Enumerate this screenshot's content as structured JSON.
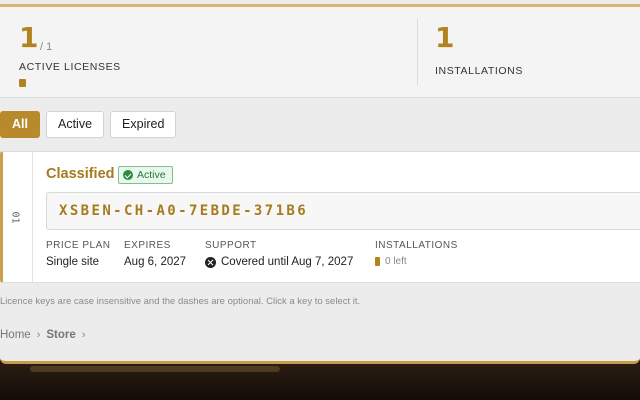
{
  "stats": {
    "active_licenses": {
      "value": "1",
      "of": "/ 1",
      "label": "ACTIVE LICENSES"
    },
    "installations": {
      "value": "1",
      "label": "INSTALLATIONS"
    }
  },
  "tabs": [
    {
      "label": "All",
      "active": true
    },
    {
      "label": "Active",
      "active": false
    },
    {
      "label": "Expired",
      "active": false
    }
  ],
  "license": {
    "index": "01",
    "name": "Classified",
    "status": "Active",
    "key": "XSBEN-CH-A0-7EBDE-371B6",
    "price_plan": {
      "label": "PRICE PLAN",
      "value": "Single site"
    },
    "expires": {
      "label": "EXPIRES",
      "value": "Aug 6, 2027"
    },
    "support": {
      "label": "SUPPORT",
      "value": "Covered until Aug 7, 2027"
    },
    "installations": {
      "label": "INSTALLATIONS",
      "value": "0 left"
    }
  },
  "note": "Licence keys are case insensitive and the dashes are optional. Click a key to select it.",
  "breadcrumb": {
    "home": "Home",
    "store": "Store"
  },
  "colors": {
    "accent": "#b88a2b",
    "active_badge": "#2d8a3f"
  }
}
